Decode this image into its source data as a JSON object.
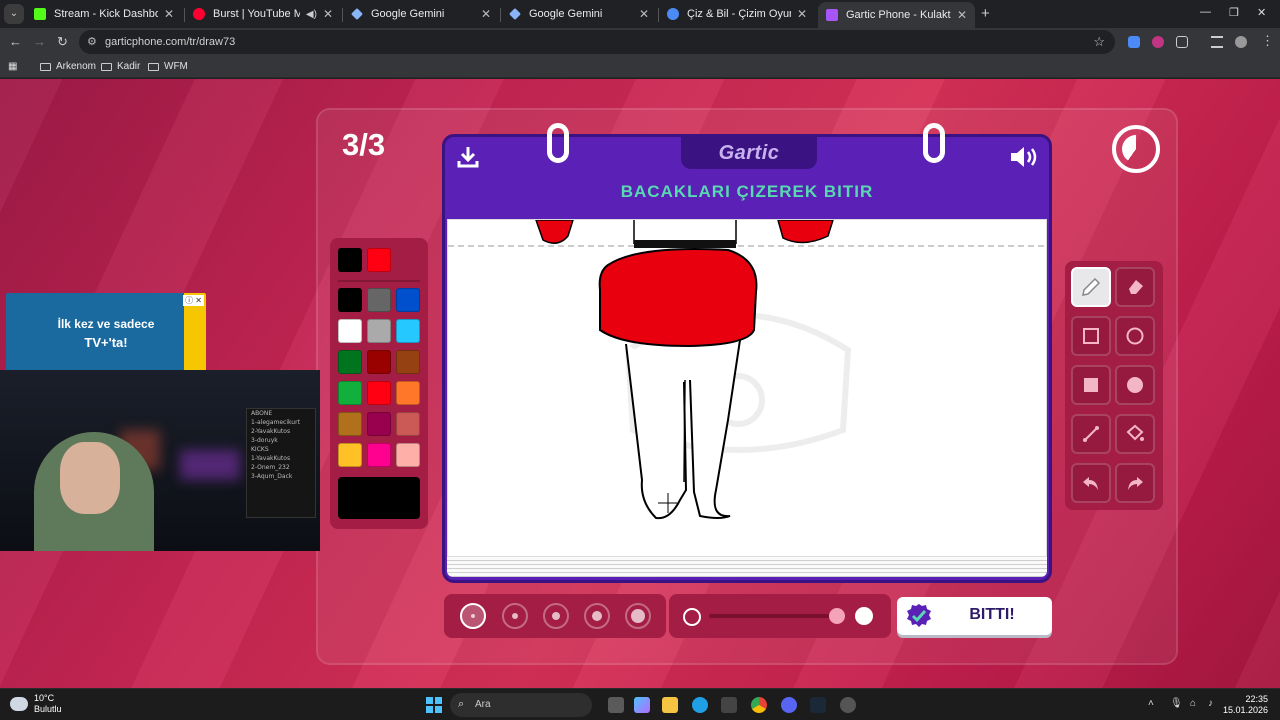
{
  "browser": {
    "tabs": [
      {
        "title": "Stream - Kick Dashboard",
        "favicon_color": "#53fc18"
      },
      {
        "title": "Burst | YouTube Music",
        "favicon_color": "#ff0033"
      },
      {
        "title": "Google Gemini",
        "favicon_color": "#8ab4f8"
      },
      {
        "title": "Google Gemini",
        "favicon_color": "#8ab4f8"
      },
      {
        "title": "Çiz & Bil - Çizim Oyunu",
        "favicon_color": "#4c8bf5"
      },
      {
        "title": "Gartic Phone - Kulaktan Kulağa",
        "favicon_color": "#a855f7"
      }
    ],
    "url": "garticphone.com/tr/draw73",
    "bookmarks": [
      "Arkenom",
      "Kadir",
      "WFM"
    ]
  },
  "game": {
    "step": "3/3",
    "logo": "Gartic",
    "prompt": "BACAKLARI ÇIZEREK BITIR",
    "done_label": "BITTI!",
    "palette_colors": [
      "#000000",
      "#666666",
      "#0050cd",
      "#ffffff",
      "#aaaaaa",
      "#26c9ff",
      "#017420",
      "#990000",
      "#964112",
      "#11b03c",
      "#ff0013",
      "#ff7829",
      "#b0701c",
      "#99004e",
      "#cb5a57",
      "#ffc126",
      "#ff008f",
      "#feafa8"
    ],
    "recent_colors": [
      "#000000",
      "#ff0013"
    ],
    "selected_color": "#000000",
    "tools": [
      "pencil-icon",
      "eraser-icon",
      "rectangle-outline-icon",
      "ellipse-outline-icon",
      "rectangle-fill-icon",
      "ellipse-fill-icon",
      "line-icon",
      "bucket-icon",
      "undo-icon",
      "redo-icon"
    ],
    "active_tool": "pencil-icon",
    "brush_sizes": 5,
    "active_brush_size": 1,
    "opacity_level": 1.0,
    "accent_colors": {
      "primary": "#5b21b6",
      "prompt": "#58d9b0",
      "background": "#c52552"
    }
  },
  "overlay": {
    "ad_line1": "İlk kez ve sadece",
    "ad_line2": "TV+'ta!",
    "board_lines": [
      "ABONE",
      "1-alegamecikurt",
      "2-YavakKutos",
      "3-doruyk",
      "KICKS",
      "1-YavakKutos",
      "2-Onem_232",
      "3-Aqum_Dack"
    ]
  },
  "taskbar": {
    "temperature": "10°C",
    "weather": "Bulutlu",
    "search_placeholder": "Ara",
    "time": "22:35",
    "date": "15.01.2026"
  }
}
